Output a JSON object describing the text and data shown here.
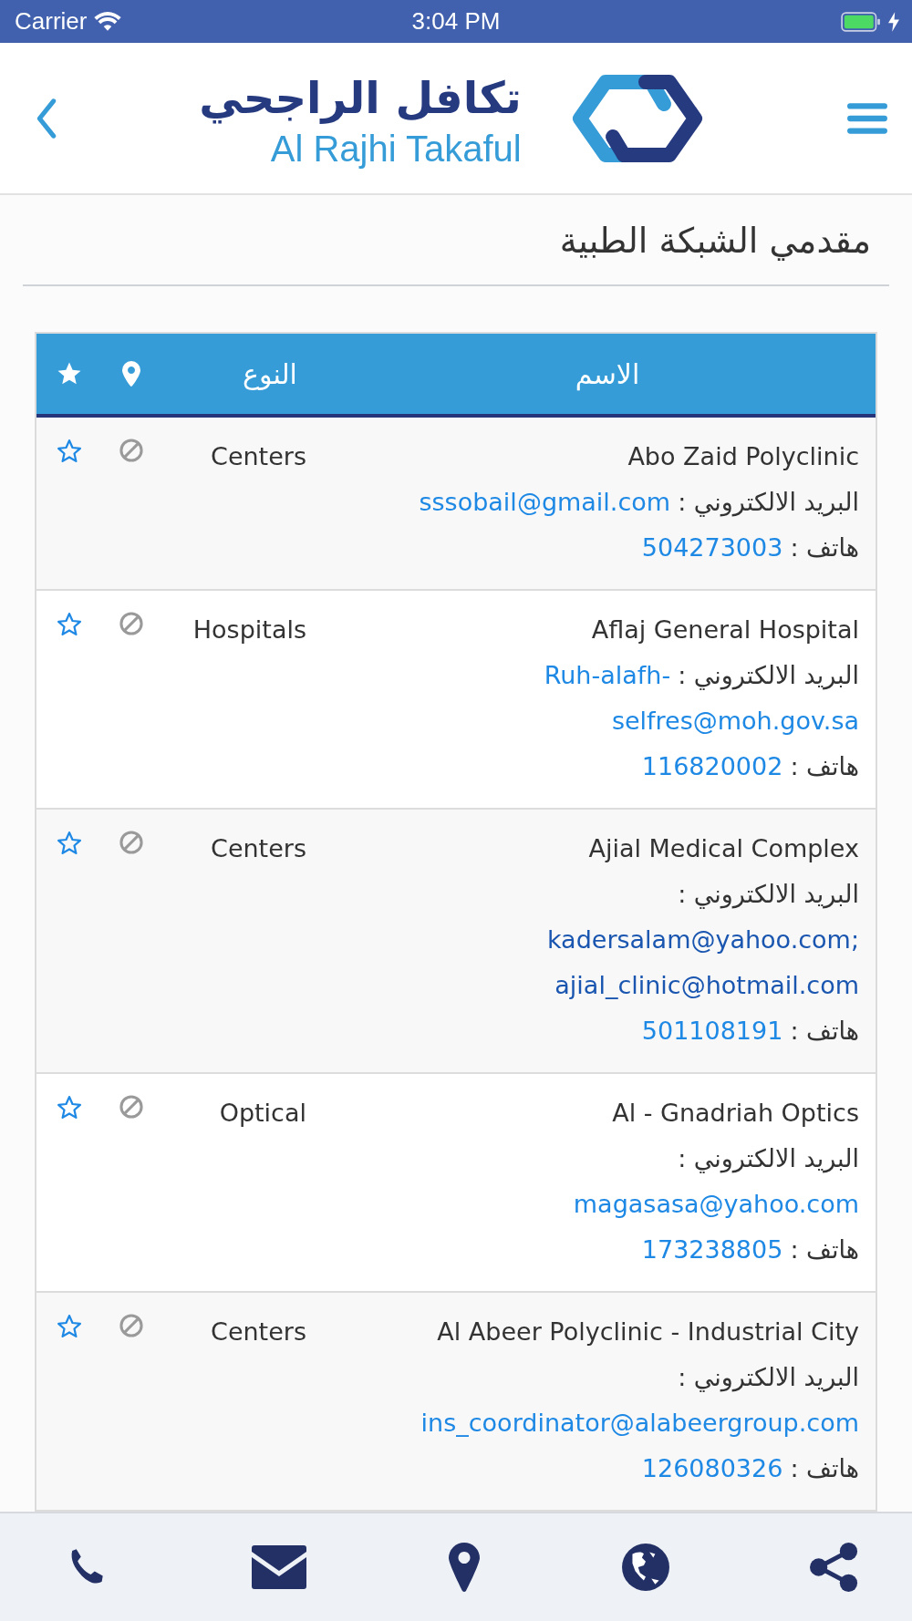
{
  "status_bar": {
    "carrier": "Carrier",
    "time": "3:04 PM"
  },
  "header": {
    "logo_arabic": "تكافل الراجحي",
    "logo_latin": "Al Rajhi Takaful"
  },
  "page_title": "مقدمي الشبكة الطبية",
  "table": {
    "columns": [
      "الاسم",
      "النوع"
    ],
    "rows": [
      {
        "name": "Abo Zaid Polyclinic",
        "type": "Centers",
        "email_label": "البريد الالكتروني :",
        "email_on_label_line": true,
        "email_lines": [
          "sssobail@gmail.com"
        ],
        "email_visited": false,
        "phone_label": "هاتف :",
        "phone": "504273003"
      },
      {
        "name": "Aflaj General Hospital",
        "type": "Hospitals",
        "email_label": "البريد الالكتروني :",
        "email_on_label_line": true,
        "email_lines": [
          "Ruh-alafh-",
          "selfres@moh.gov.sa"
        ],
        "email_visited": false,
        "phone_label": "هاتف :",
        "phone": "116820002"
      },
      {
        "name": "Ajial Medical Complex",
        "type": "Centers",
        "email_label": "البريد الالكتروني :",
        "email_on_label_line": false,
        "email_lines": [
          "kadersalam@yahoo.com;",
          "ajial_clinic@hotmail.com"
        ],
        "email_visited": true,
        "phone_label": "هاتف :",
        "phone": "501108191"
      },
      {
        "name": "Al - Gnadriah Optics",
        "type": "Optical",
        "email_label": "البريد الالكتروني :",
        "email_on_label_line": false,
        "email_lines": [
          "magasasa@yahoo.com"
        ],
        "email_visited": false,
        "phone_label": "هاتف :",
        "phone": "173238805"
      },
      {
        "name": "Al Abeer Polyclinic - Industrial City",
        "type": "Centers",
        "email_label": "البريد الالكتروني :",
        "email_on_label_line": false,
        "email_lines": [
          "ins_coordinator@alabeergroup.com"
        ],
        "email_visited": false,
        "phone_label": "هاتف :",
        "phone": "126080326"
      }
    ]
  }
}
